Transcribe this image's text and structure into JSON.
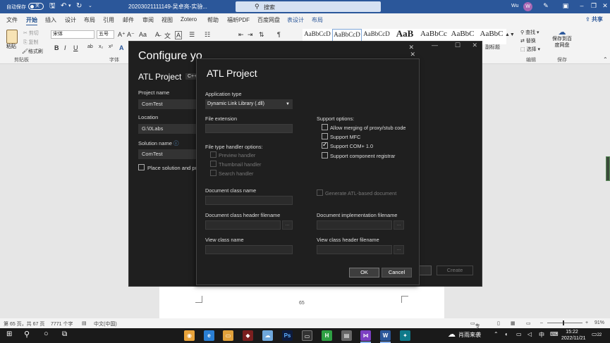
{
  "word": {
    "autosave_label": "自动保存",
    "autosave_state": "关",
    "doc_title": "20203021111149-吴卓亮-实验...",
    "search_placeholder": "搜索",
    "user_name": "Wu",
    "avatar_letter": "W",
    "share_label": "共享",
    "tabs": [
      "文件",
      "开始",
      "插入",
      "设计",
      "布局",
      "引用",
      "邮件",
      "审阅",
      "视图",
      "Zotero",
      "帮助",
      "福昕PDF",
      "百度网盘",
      "表设计",
      "布局"
    ],
    "ribbon": {
      "paste_label": "粘贴",
      "cut_label": "剪切",
      "copy_label": "复制",
      "format_painter_label": "格式刷",
      "clipboard_group": "剪贴板",
      "font_group": "字体",
      "font_name": "宋体",
      "font_size": "五号",
      "bold": "B",
      "italic": "I",
      "underline": "U",
      "styles": [
        "AaBbCcD",
        "AaBbCcD",
        "AaBbCcD",
        "AaB",
        "AaBbCc",
        "AaBbC",
        "AaBbC"
      ],
      "style_tail_label": "副标题",
      "find_label": "查找",
      "replace_label": "替换",
      "select_label": "选择",
      "editing_group": "编辑",
      "save_baidu_label": "保存到百度网盘",
      "save_group": "保存"
    },
    "page_number": "65",
    "status": {
      "page": "第 65 页，共 67 页",
      "words": "7771 个字",
      "language": "中文(中国)",
      "focus": "专注",
      "zoom": "91%"
    }
  },
  "outer_dialog": {
    "heading": "Configure yo",
    "project_type": "ATL Project",
    "lang_badge": "C++",
    "project_name_label": "Project name",
    "project_name_value": "ComTest",
    "location_label": "Location",
    "location_value": "G:\\0Labs",
    "solution_name_label": "Solution name",
    "solution_name_value": "ComTest",
    "place_solution_label": "Place solution and pr",
    "back_partial": "k",
    "create_label": "Create"
  },
  "atl_dialog": {
    "title": "ATL Project",
    "app_type_label": "Application type",
    "app_type_value": "Dynamic Link Library (.dll)",
    "file_ext_label": "File extension",
    "handler_options_label": "File type handler options:",
    "handlers": [
      "Preview handler",
      "Thumbnail handler",
      "Search handler"
    ],
    "support_options_label": "Support options:",
    "support": [
      {
        "label": "Allow merging of proxy/stub code",
        "checked": false
      },
      {
        "label": "Support MFC",
        "checked": false
      },
      {
        "label": "Support COM+ 1.0",
        "checked": true
      },
      {
        "label": "Support component registrar",
        "checked": false
      }
    ],
    "doc_class_label": "Document class name",
    "gen_atl_doc_label": "Generate ATL-based document",
    "doc_header_label": "Document class header filename",
    "doc_impl_label": "Document implementation filename",
    "view_class_label": "View class name",
    "view_header_label": "View class header filename",
    "browse_label": "...",
    "ok_label": "OK",
    "cancel_label": "Cancel"
  },
  "taskbar": {
    "search_icon": "search-icon",
    "weather_text": "肖雨来袭",
    "ime_label": "中",
    "time": "15:22",
    "date": "2022/11/21",
    "notif_count": "22"
  }
}
